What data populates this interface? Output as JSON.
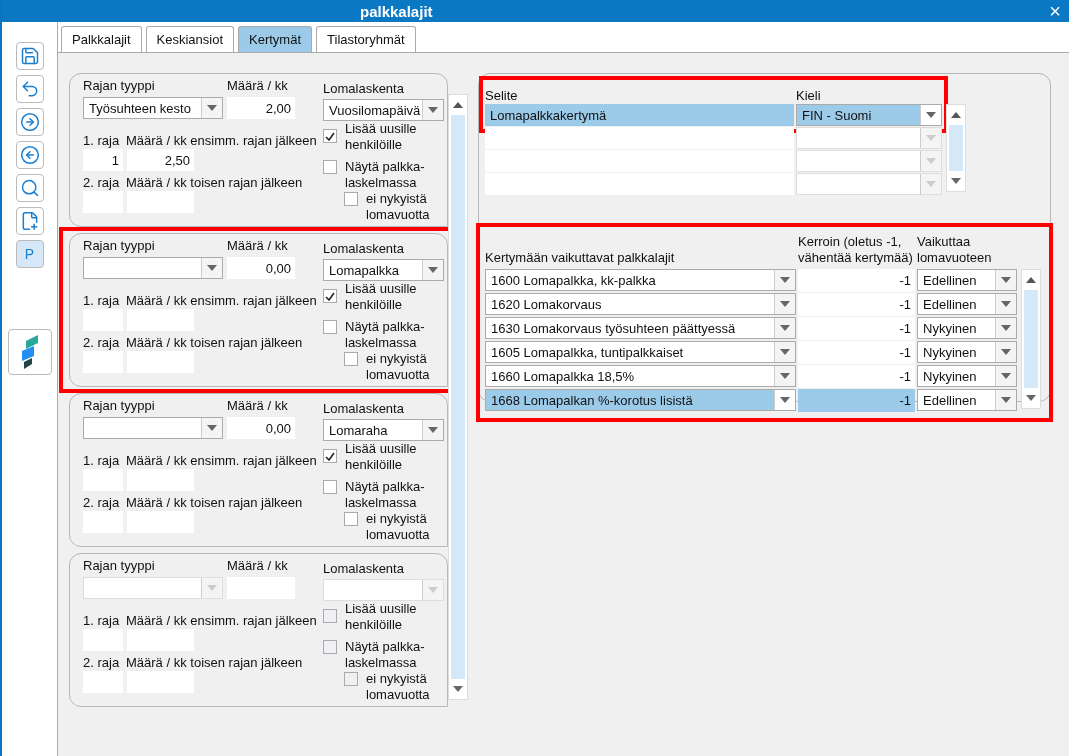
{
  "window": {
    "title": "palkkalajit",
    "close": "×"
  },
  "toolbar": [
    {
      "kind": "save"
    },
    {
      "kind": "undo"
    },
    {
      "kind": "next"
    },
    {
      "kind": "previous"
    },
    {
      "kind": "search"
    },
    {
      "kind": "add-document"
    },
    {
      "kind": "letter",
      "label": "P"
    },
    {
      "kind": "logo"
    }
  ],
  "tabs": [
    {
      "label": "Palkkalajit",
      "selected": false
    },
    {
      "label": "Keskiansiot",
      "selected": false
    },
    {
      "label": "Kertymät",
      "selected": true
    },
    {
      "label": "Tilastoryhmät",
      "selected": false
    }
  ],
  "limit_groups": [
    {
      "highlighted": false,
      "disabled": false,
      "type_label": "Rajan tyyppi",
      "type_value": "Työsuhteen kesto",
      "amount_label": "Määrä / kk",
      "amount_value": "2,00",
      "calc_label": "Lomalaskenta",
      "calc_value": "Vuosilomapäivä",
      "limit1_label": "1. raja",
      "amount1_label": "Määrä / kk ensimm. rajan jälkeen",
      "limit1_value": "1",
      "amount1_value": "2,50",
      "limit2_label": "2. raja",
      "amount2_label": "Määrä / kk toisen rajan jälkeen",
      "add_new": {
        "label": "Lisää uusille henkilöille",
        "checked": true
      },
      "show_payslip": {
        "label": "Näytä palkka-laskelmassa",
        "checked": false
      },
      "no_current": {
        "label": "ei nykyistä lomavuotta",
        "checked": false
      }
    },
    {
      "highlighted": true,
      "disabled": false,
      "type_label": "Rajan tyyppi",
      "amount_label": "Määrä / kk",
      "amount_value": "0,00",
      "calc_label": "Lomalaskenta",
      "calc_value": "Lomapalkka",
      "limit1_label": "1. raja",
      "amount1_label": "Määrä / kk ensimm. rajan jälkeen",
      "limit2_label": "2. raja",
      "amount2_label": "Määrä / kk toisen rajan jälkeen",
      "add_new": {
        "label": "Lisää uusille henkilöille",
        "checked": true
      },
      "show_payslip": {
        "label": "Näytä palkka-laskelmassa",
        "checked": false
      },
      "no_current": {
        "label": "ei nykyistä lomavuotta",
        "checked": false
      }
    },
    {
      "highlighted": false,
      "disabled": false,
      "type_label": "Rajan tyyppi",
      "amount_label": "Määrä / kk",
      "amount_value": "0,00",
      "calc_label": "Lomalaskenta",
      "calc_value": "Lomaraha",
      "limit1_label": "1. raja",
      "amount1_label": "Määrä / kk ensimm. rajan jälkeen",
      "limit2_label": "2. raja",
      "amount2_label": "Määrä / kk toisen rajan jälkeen",
      "add_new": {
        "label": "Lisää uusille henkilöille",
        "checked": true
      },
      "show_payslip": {
        "label": "Näytä palkka-laskelmassa",
        "checked": false
      },
      "no_current": {
        "label": "ei nykyistä lomavuotta",
        "checked": false
      }
    },
    {
      "highlighted": false,
      "disabled": true,
      "type_label": "Rajan tyyppi",
      "amount_label": "Määrä / kk",
      "calc_label": "Lomalaskenta",
      "limit1_label": "1. raja",
      "amount1_label": "Määrä / kk ensimm. rajan jälkeen",
      "limit2_label": "2. raja",
      "amount2_label": "Määrä / kk toisen rajan jälkeen",
      "add_new": {
        "label": "Lisää uusille henkilöille",
        "checked": false
      },
      "show_payslip": {
        "label": "Näytä palkka-laskelmassa",
        "checked": false
      },
      "no_current": {
        "label": "ei nykyistä lomavuotta",
        "checked": false
      }
    }
  ],
  "descriptions": {
    "highlighted": true,
    "columns": [
      "Selite",
      "Kieli"
    ],
    "rows": [
      {
        "text": "Lomapalkkakertymä",
        "language": "FIN - Suomi",
        "selected": true
      }
    ]
  },
  "wage_types": {
    "highlighted": true,
    "columns": [
      "Kertymään vaikuttavat palkkalajit",
      "Kerroin (oletus -1, vähentää kertymää)",
      "Vaikuttaa lomavuoteen"
    ],
    "rows": [
      {
        "wage_type": "1600 Lomapalkka, kk-palkka",
        "factor": "-1",
        "year": "Edellinen",
        "selected": false
      },
      {
        "wage_type": "1620 Lomakorvaus",
        "factor": "-1",
        "year": "Edellinen",
        "selected": false
      },
      {
        "wage_type": "1630 Lomakorvaus työsuhteen päättyessä",
        "factor": "-1",
        "year": "Nykyinen",
        "selected": false
      },
      {
        "wage_type": "1605 Lomapalkka, tuntipalkkaiset",
        "factor": "-1",
        "year": "Nykyinen",
        "selected": false
      },
      {
        "wage_type": "1660 Lomapalkka 18,5%",
        "factor": "-1",
        "year": "Nykyinen",
        "selected": false
      },
      {
        "wage_type": "1668 Lomapalkan %-korotus lisistä",
        "factor": "-1",
        "year": "Edellinen",
        "selected": true
      }
    ]
  }
}
